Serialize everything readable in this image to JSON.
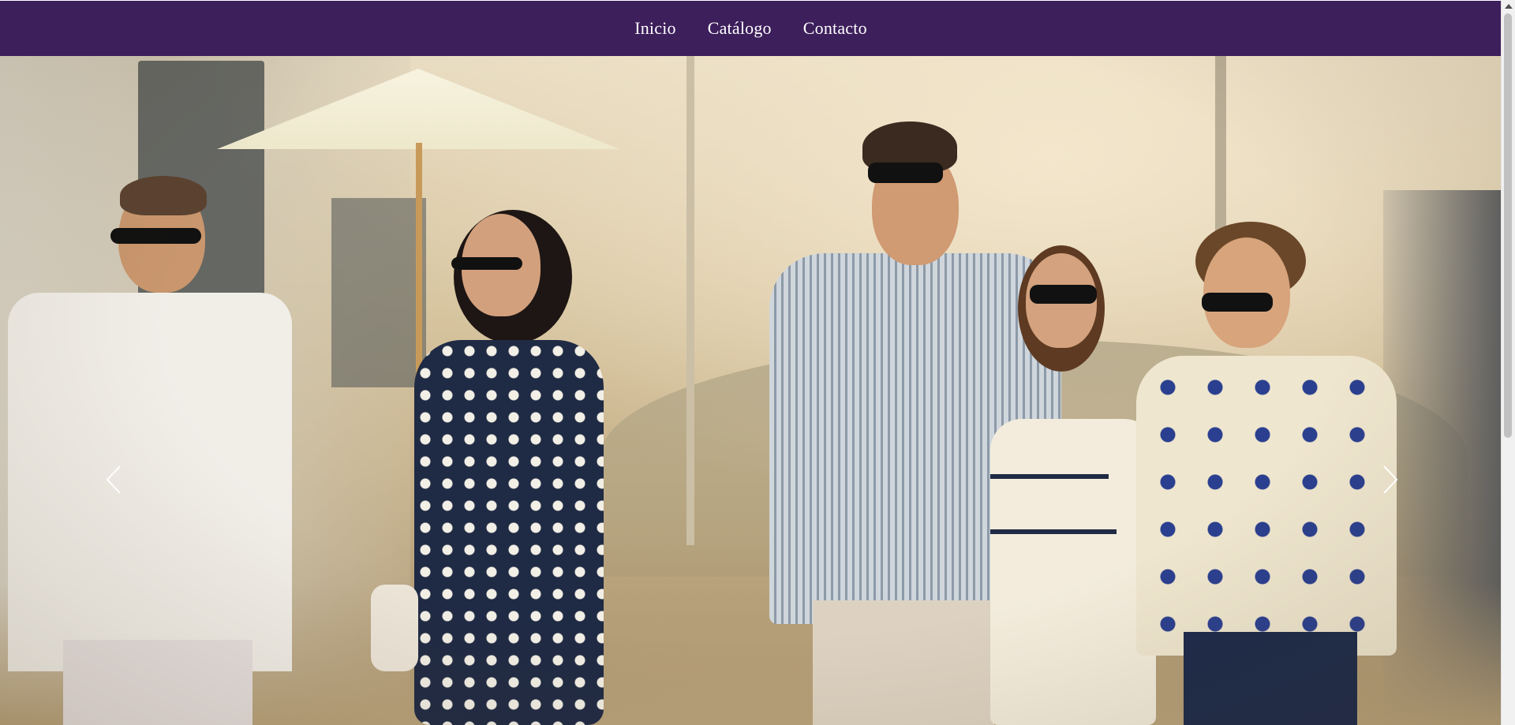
{
  "nav": {
    "items": [
      {
        "label": "Inicio"
      },
      {
        "label": "Catálogo"
      },
      {
        "label": "Contacto"
      }
    ]
  },
  "hero": {
    "image_icon": "hero-photo-group-walking-on-dock",
    "prev_icon": "chevron-left-icon",
    "next_icon": "chevron-right-icon"
  },
  "colors": {
    "nav_background": "#3d1f5c",
    "nav_text": "#ffffff",
    "arrow": "#ffffff"
  }
}
